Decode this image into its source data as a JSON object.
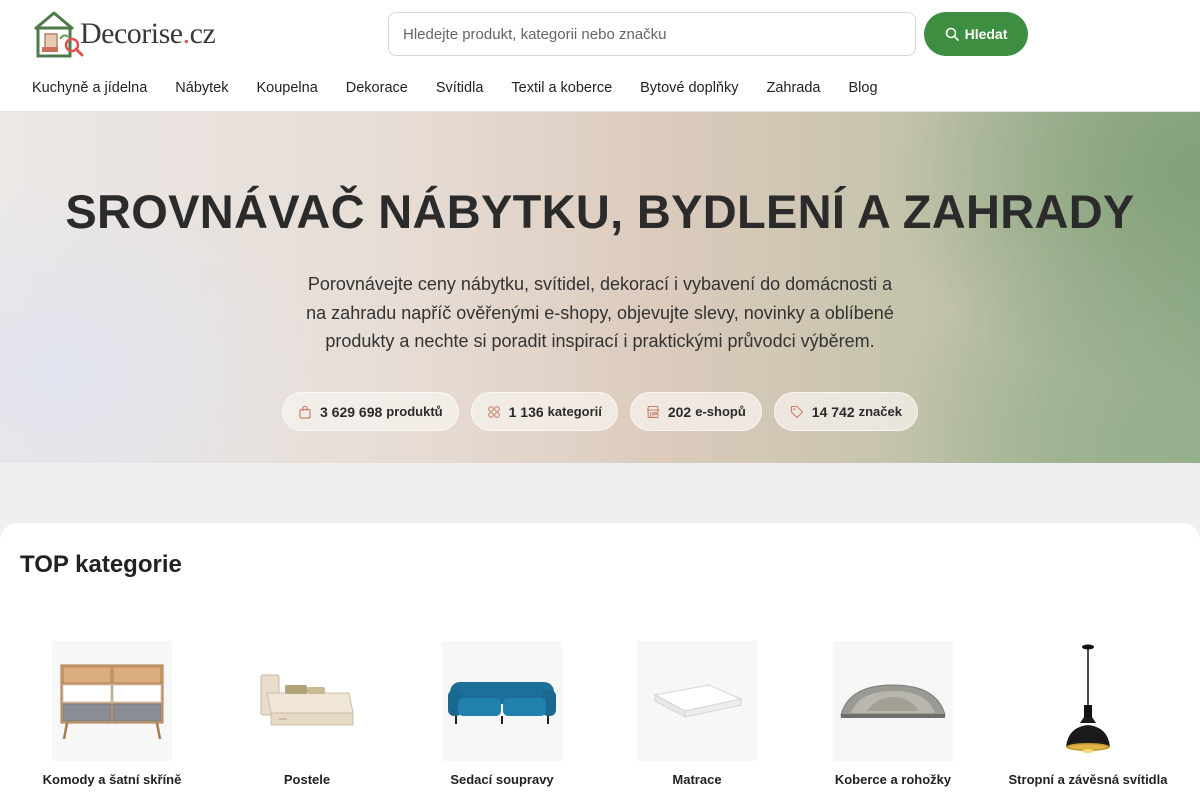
{
  "header": {
    "logo_text": "Decorise",
    "logo_tld": ".cz",
    "search_placeholder": "Hledejte produkt, kategorii nebo značku",
    "search_button": "Hledat"
  },
  "nav": [
    "Kuchyně a jídelna",
    "Nábytek",
    "Koupelna",
    "Dekorace",
    "Svítidla",
    "Textil a koberce",
    "Bytové doplňky",
    "Zahrada",
    "Blog"
  ],
  "hero": {
    "title": "SROVNÁVAČ NÁBYTKU, BYDLENÍ A ZAHRADY",
    "description": "Porovnávejte ceny nábytku, svítidel, dekorací i vybavení do domácnosti a na zahradu napříč ověřenými e-shopy, objevujte slevy, novinky a oblíbené produkty a nechte si poradit inspirací i praktickými průvodci výběrem.",
    "stats": [
      {
        "value": "3 629 698",
        "label": "produktů",
        "icon": "shopping-bag-icon"
      },
      {
        "value": "1 136",
        "label": "kategorií",
        "icon": "categories-grid-icon"
      },
      {
        "value": "202",
        "label": "e-shopů",
        "icon": "store-icon"
      },
      {
        "value": "14 742",
        "label": "značek",
        "icon": "tag-icon"
      }
    ]
  },
  "top_categories": {
    "title": "TOP kategorie",
    "items": [
      {
        "name": "Komody a šatní skříně",
        "icon": "dresser-image"
      },
      {
        "name": "Postele",
        "icon": "bed-image"
      },
      {
        "name": "Sedací soupravy",
        "icon": "sofa-image"
      },
      {
        "name": "Matrace",
        "icon": "mattress-image"
      },
      {
        "name": "Koberce a rohožky",
        "icon": "rug-image"
      },
      {
        "name": "Stropní a závěsná svítidla",
        "icon": "pendant-lamp-image"
      }
    ]
  },
  "colors": {
    "accent": "#3e8e41",
    "logo_dot": "#d9534f",
    "stat_icon": "#c9826a"
  }
}
